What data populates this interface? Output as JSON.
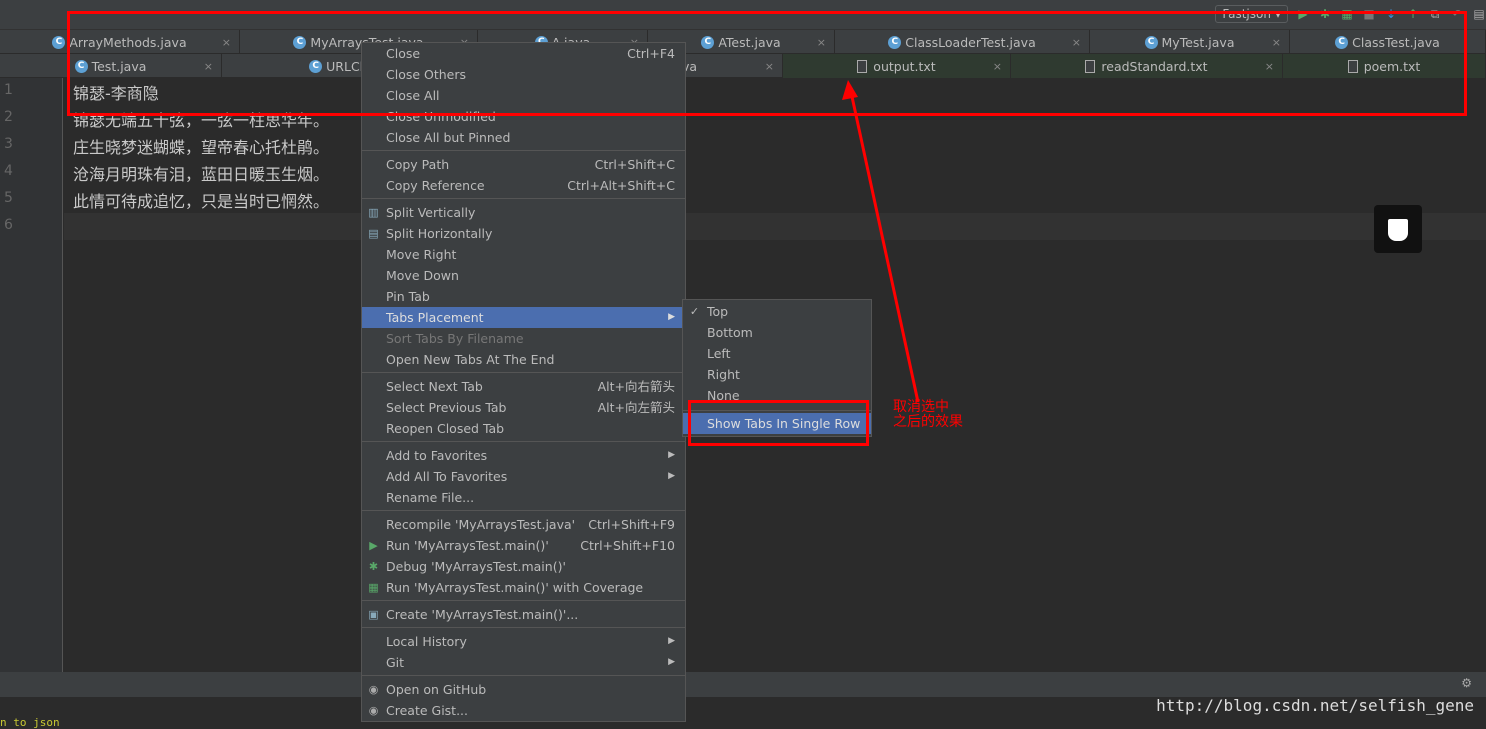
{
  "toolbar": {
    "run_config": "Fastjson"
  },
  "tabs_row1": [
    {
      "label": "ArrayMethods.java"
    },
    {
      "label": "MyArraysTest.java"
    },
    {
      "label": "A.java"
    },
    {
      "label": "ATest.java"
    },
    {
      "label": "ClassLoaderTest.java"
    },
    {
      "label": "MyTest.java"
    },
    {
      "label": "ClassTest.java"
    }
  ],
  "tabs_row2": [
    {
      "label": "Test.java"
    },
    {
      "label": "URLClass"
    },
    {
      "label": "va"
    },
    {
      "label": "output.txt"
    },
    {
      "label": "readStandard.txt"
    },
    {
      "label": "poem.txt"
    }
  ],
  "editor": {
    "lines": [
      "锦瑟-李商隐",
      "锦瑟无端五十弦，一弦一柱思华年。",
      "庄生晓梦迷蝴蝶，望帝春心托杜鹃。",
      "沧海月明珠有泪，蓝田日暖玉生烟。",
      "此情可待成追忆，只是当时已惘然。",
      ""
    ],
    "line_numbers": [
      "1",
      "2",
      "3",
      "4",
      "5",
      "6"
    ]
  },
  "menu": {
    "groups": [
      [
        {
          "label": "Close",
          "shortcut": "Ctrl+F4"
        },
        {
          "label": "Close Others"
        },
        {
          "label": "Close All"
        },
        {
          "label": "Close Unmodified"
        },
        {
          "label": "Close All but Pinned"
        }
      ],
      [
        {
          "label": "Copy Path",
          "shortcut": "Ctrl+Shift+C"
        },
        {
          "label": "Copy Reference",
          "shortcut": "Ctrl+Alt+Shift+C"
        }
      ],
      [
        {
          "label": "Split Vertically",
          "icon": "split-vertical-icon"
        },
        {
          "label": "Split Horizontally",
          "icon": "split-horizontal-icon"
        },
        {
          "label": "Move Right"
        },
        {
          "label": "Move Down"
        },
        {
          "label": "Pin Tab"
        },
        {
          "label": "Tabs Placement",
          "submenu": true,
          "highlighted": true
        },
        {
          "label": "Sort Tabs By Filename",
          "disabled": true
        },
        {
          "label": "Open New Tabs At The End"
        }
      ],
      [
        {
          "label": "Select Next Tab",
          "shortcut": "Alt+向右箭头"
        },
        {
          "label": "Select Previous Tab",
          "shortcut": "Alt+向左箭头"
        },
        {
          "label": "Reopen Closed Tab"
        }
      ],
      [
        {
          "label": "Add to Favorites",
          "submenu": true
        },
        {
          "label": "Add All To Favorites",
          "submenu": true
        },
        {
          "label": "Rename File..."
        }
      ],
      [
        {
          "label": "Recompile 'MyArraysTest.java'",
          "shortcut": "Ctrl+Shift+F9"
        },
        {
          "label": "Run 'MyArraysTest.main()'",
          "shortcut": "Ctrl+Shift+F10",
          "icon": "run-icon"
        },
        {
          "label": "Debug 'MyArraysTest.main()'",
          "icon": "debug-icon"
        },
        {
          "label": "Run 'MyArraysTest.main()' with Coverage",
          "icon": "coverage-icon"
        }
      ],
      [
        {
          "label": "Create 'MyArraysTest.main()'...",
          "icon": "create-config-icon"
        }
      ],
      [
        {
          "label": "Local History",
          "submenu": true
        },
        {
          "label": "Git",
          "submenu": true
        }
      ],
      [
        {
          "label": "Open on GitHub",
          "icon": "github-icon"
        },
        {
          "label": "Create Gist...",
          "icon": "github-icon"
        }
      ]
    ]
  },
  "submenu": {
    "items": [
      {
        "label": "Top",
        "checked": true
      },
      {
        "label": "Bottom"
      },
      {
        "label": "Left"
      },
      {
        "label": "Right"
      },
      {
        "label": "None"
      }
    ],
    "single_row": {
      "label": "Show Tabs In Single Row",
      "highlighted": true
    }
  },
  "annotation": {
    "line1": "取消选中",
    "line2": "之后的效果",
    "color": "#ff0000"
  },
  "bottom_text": "n to json",
  "watermark": "http://blog.csdn.net/selfish_gene",
  "colors": {
    "highlight": "#4b6eaf",
    "background": "#2b2b2b",
    "panel": "#3c3f41"
  }
}
